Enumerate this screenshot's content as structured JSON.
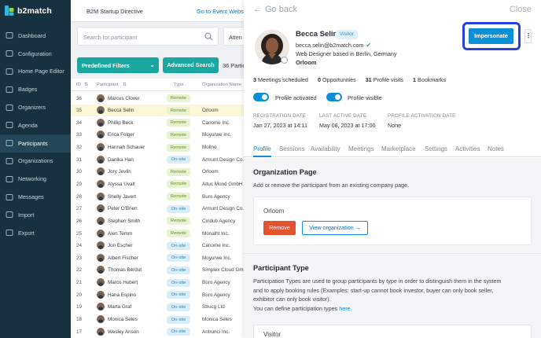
{
  "brand": {
    "name": "b2match"
  },
  "sidebar": {
    "items": [
      {
        "label": "Dashboard",
        "icon": "dashboard-icon"
      },
      {
        "label": "Configuration",
        "icon": "gear-icon"
      },
      {
        "label": "Home Page Editor",
        "icon": "edit-icon"
      },
      {
        "label": "Badges",
        "icon": "badge-icon"
      },
      {
        "label": "Organizers",
        "icon": "organizers-icon"
      },
      {
        "label": "Agenda",
        "icon": "calendar-icon"
      },
      {
        "label": "Participants",
        "icon": "participants-icon"
      },
      {
        "label": "Organizations",
        "icon": "building-icon"
      },
      {
        "label": "Networking",
        "icon": "network-icon"
      },
      {
        "label": "Messages",
        "icon": "mail-icon"
      },
      {
        "label": "Import",
        "icon": "import-icon"
      },
      {
        "label": "Export",
        "icon": "export-icon"
      }
    ],
    "active_index": 6
  },
  "topbar": {
    "title": "B2M Startup Directive",
    "event_link": "Go to Event Website"
  },
  "search": {
    "placeholder": "Search for participant",
    "attendance_label": "Atten"
  },
  "filters": {
    "predefined_label": "Predefined Filters",
    "advanced_label": "Advanced Search",
    "count_text": "36 Partic"
  },
  "table": {
    "headers": {
      "id": "ID",
      "participant": "Participant",
      "type": "Type",
      "organization": "Organization Name"
    },
    "rows": [
      {
        "id": "36",
        "name": "Marcus Clover",
        "type": "Remote",
        "org": ""
      },
      {
        "id": "35",
        "name": "Becca Selin",
        "type": "Remote",
        "org": "Orloom",
        "highlight": true
      },
      {
        "id": "34",
        "name": "Phillip Beck",
        "type": "Remote",
        "org": "Canome Inc."
      },
      {
        "id": "33",
        "name": "Erica Folger",
        "type": "Remote",
        "org": "Moyurwe Inc."
      },
      {
        "id": "32",
        "name": "Hannah Schauer",
        "type": "Remote",
        "org": "Mollno"
      },
      {
        "id": "31",
        "name": "Danika Han",
        "type": "On-site",
        "org": "Armunt Design Co."
      },
      {
        "id": "30",
        "name": "Jory Jevlin",
        "type": "Remote",
        "org": "Orloom"
      },
      {
        "id": "29",
        "name": "Alyssa Uvalt",
        "type": "Remote",
        "org": "Altuc Mond GmbH"
      },
      {
        "id": "28",
        "name": "Shelly Javert",
        "type": "Remote",
        "org": "Buro Agency"
      },
      {
        "id": "27",
        "name": "Peter O'Brien",
        "type": "On-site",
        "org": "Armunt Design Co."
      },
      {
        "id": "26",
        "name": "Stephen Smith",
        "type": "Remote",
        "org": "Cindub Agency"
      },
      {
        "id": "25",
        "name": "Alen Temm",
        "type": "Remote",
        "org": "Monalht Inc."
      },
      {
        "id": "24",
        "name": "Jon Escher",
        "type": "On-site",
        "org": "Canome Inc."
      },
      {
        "id": "23",
        "name": "Albert Fischer",
        "type": "On-site",
        "org": "Moyurwe Inc."
      },
      {
        "id": "22",
        "name": "Thomas Berdut",
        "type": "On-site",
        "org": "Simplex Cloud GmbH"
      },
      {
        "id": "21",
        "name": "Marco Hubert",
        "type": "On-site",
        "org": "Buro Agency"
      },
      {
        "id": "20",
        "name": "Hana Espino",
        "type": "On-site",
        "org": "Buro Agency"
      },
      {
        "id": "19",
        "name": "Marta Graf",
        "type": "On-site",
        "org": "Strucg Ltd"
      },
      {
        "id": "18",
        "name": "Monica Seles",
        "type": "On-site",
        "org": "Monica Seles"
      },
      {
        "id": "17",
        "name": "Wesley Anson",
        "type": "On-site",
        "org": "Antrunci Inc."
      }
    ]
  },
  "panel": {
    "back_label": "Go back",
    "close_label": "Close",
    "name": "Becca Selin",
    "badge": "Visitor",
    "email": "becca.selin@b2match.com",
    "job": "Web Designer based in Berlin, Germany",
    "organization": "Orloom",
    "impersonate_label": "Impersonate",
    "more_label": "⋮",
    "stats": [
      {
        "value": "3",
        "label": "Meetings scheduled"
      },
      {
        "value": "0",
        "label": "Opportunities"
      },
      {
        "value": "31",
        "label": "Profile visits"
      },
      {
        "value": "1",
        "label": "Bookmarks"
      }
    ],
    "toggles": {
      "activated": "Profile activated",
      "visible": "Profile visible"
    },
    "dates": {
      "registration_label": "REGISTRATION DATE",
      "registration_value": "Jan 27, 2023 at 14:11",
      "last_active_label": "LAST ACTIVE DATE",
      "last_active_value": "May 08, 2023 at 17:00",
      "activation_label": "PROFILE ACTIVATION DATE",
      "activation_value": "None"
    },
    "tabs": [
      "Profile",
      "Sessions",
      "Availability",
      "Meetings",
      "Marketplace",
      "Settings",
      "Activities",
      "Notes"
    ],
    "org_page": {
      "title": "Organization Page",
      "text": "Add or remove the participant from an existing company page.",
      "org_name": "Orloom",
      "remove_label": "Remove",
      "view_label": "View organization"
    },
    "participant_type": {
      "title": "Participant Type",
      "text1": "Participation Types are used to group participants by type in order to distinguish them in the system",
      "text2": "and to apply booking rules (Examples: start-up cannot book investor, buyer can only book seller,",
      "text3": "exhibitor can only book visitor).",
      "text4": "You can define participation types ",
      "link": "here",
      "text5": ".",
      "selected": "Visitor"
    }
  },
  "colors": {
    "accent": "#0d8fd6",
    "teal": "#1aa7a0",
    "sidebar": "#173140",
    "highlight_frame": "#2742d6"
  }
}
